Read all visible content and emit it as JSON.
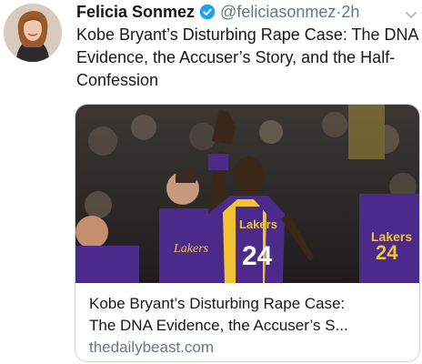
{
  "tweet": {
    "author_name": "Felicia Sonmez",
    "handle": "@feliciasonmez",
    "separator": "·",
    "time": "2h",
    "text": "Kobe Bryant’s Disturbing Rape Case: The DNA Evidence, the Accuser’s Story, and the Half-Confession"
  },
  "card": {
    "title_line1": "Kobe Bryant’s Disturbing Rape Case:",
    "title_line2": "The DNA Evidence, the Accuser’s S...",
    "domain": "thedailybeast.com",
    "image": {
      "jersey_lettering_left": "Lakers",
      "jersey_lettering_main": "Lakers",
      "jersey_number_main": "24",
      "jersey_lettering_bg": "Lakers",
      "jersey_number_bg": "24"
    }
  },
  "colors": {
    "verified": "#1da1f2",
    "lakers_purple": "#4b2a8c",
    "lakers_gold": "#f1c232",
    "muted_text": "#657786"
  },
  "icons": {
    "verified": "verified-badge-icon",
    "chevron": "chevron-down-icon"
  }
}
